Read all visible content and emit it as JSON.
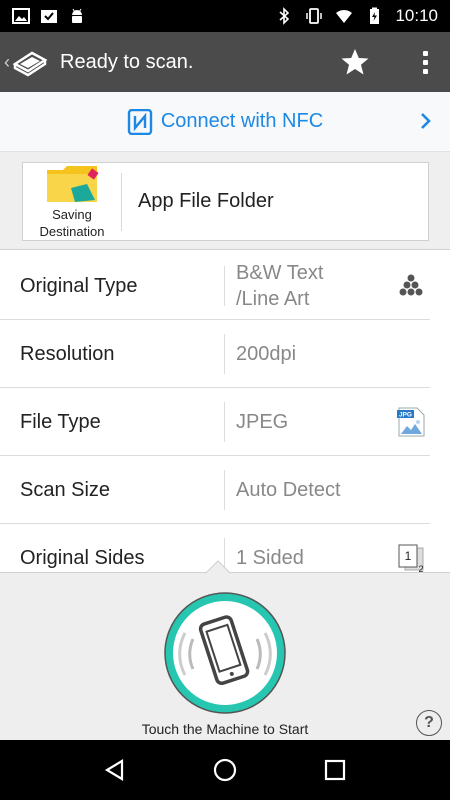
{
  "status_bar": {
    "time": "10:10",
    "left_icons": [
      "image-icon",
      "inbox-check-icon",
      "android-icon"
    ],
    "right_icons": [
      "bluetooth-icon",
      "vibrate-icon",
      "wifi-icon",
      "battery-charging-icon"
    ]
  },
  "app_bar": {
    "title": "Ready to scan.",
    "back_glyph": "‹",
    "icons": [
      "app-logo-icon",
      "star-icon",
      "more-vert-icon"
    ]
  },
  "nfc": {
    "label": "Connect with NFC",
    "accent": "#1e88e5"
  },
  "destination": {
    "caption_line1": "Saving",
    "caption_line2": "Destination",
    "value": "App File Folder"
  },
  "settings": {
    "rows": [
      {
        "label": "Original Type",
        "value_line1": "B&W Text",
        "value_line2": "/Line Art",
        "icon": "dots-icon"
      },
      {
        "label": "Resolution",
        "value": "200dpi"
      },
      {
        "label": "File Type",
        "value": "JPEG",
        "icon": "jpg-file-icon",
        "icon_text": "JPG"
      },
      {
        "label": "Scan Size",
        "value": "Auto Detect"
      },
      {
        "label": "Original Sides",
        "value": "1 Sided",
        "icon": "sides-icon",
        "icon_text_1": "1",
        "icon_text_2": "2"
      }
    ]
  },
  "bottom": {
    "caption": "Touch the Machine to Start",
    "help": "?",
    "button_color": "#26c6b0"
  },
  "nav": {
    "icons": [
      "back-triangle-icon",
      "home-circle-icon",
      "recents-square-icon"
    ]
  }
}
